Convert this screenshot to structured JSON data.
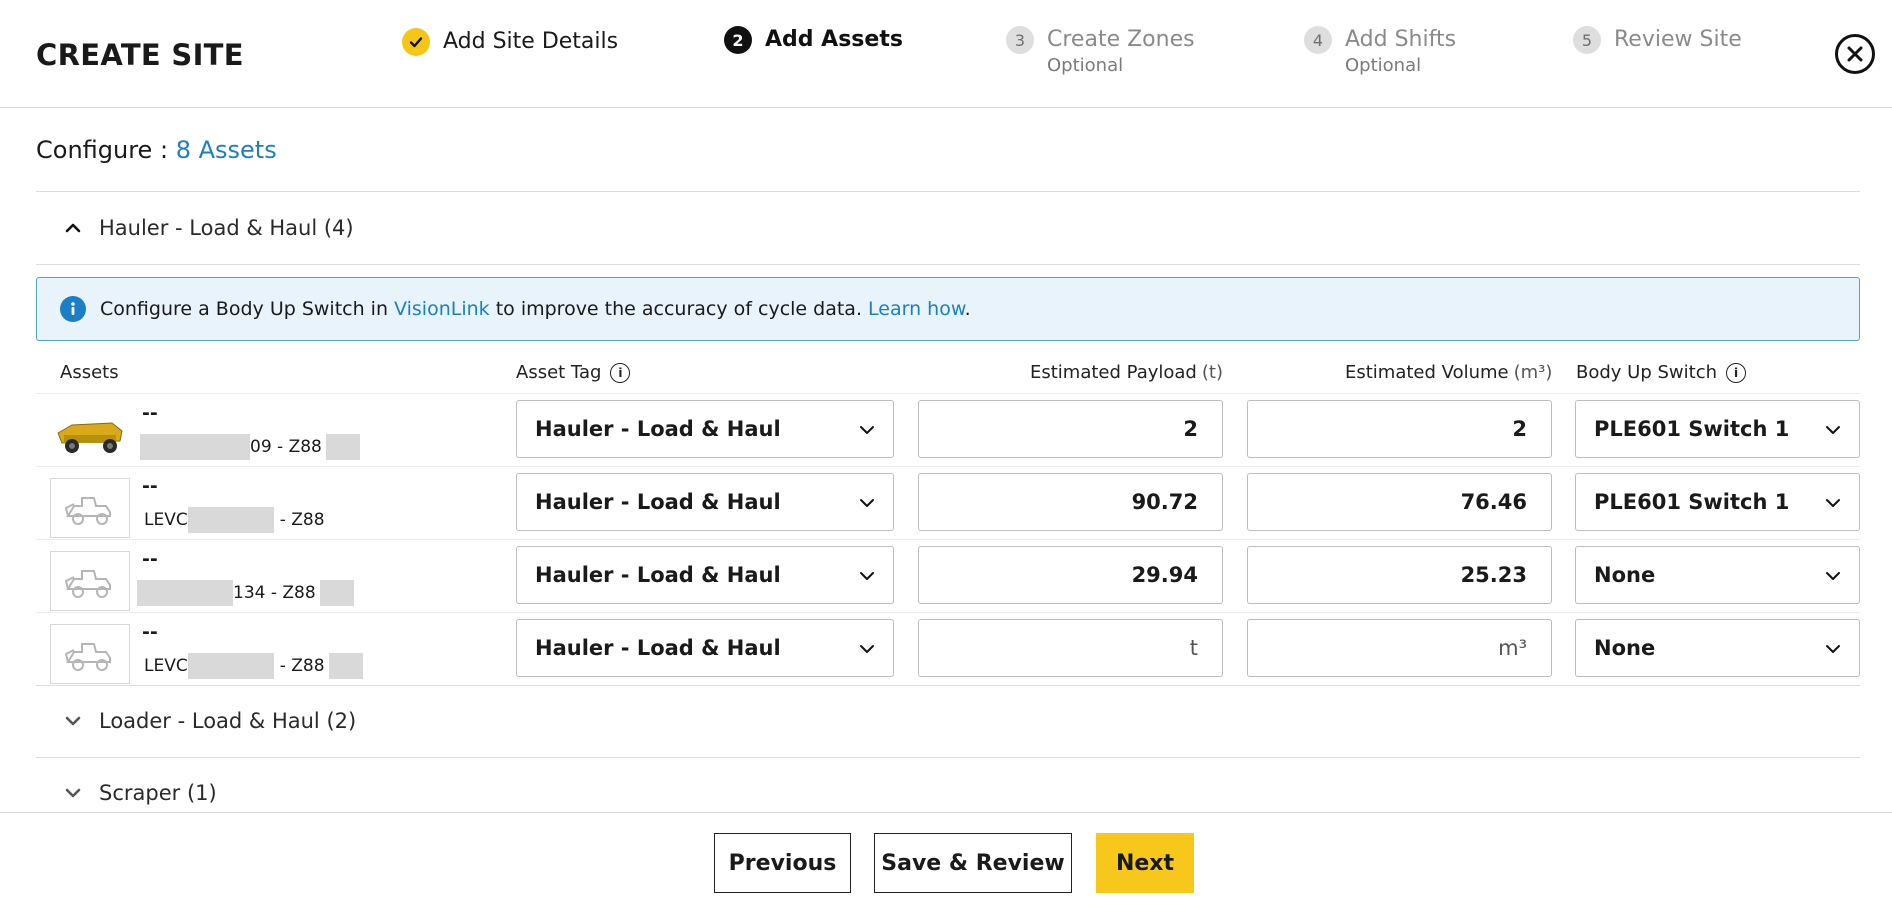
{
  "header": {
    "title": "CREATE SITE",
    "steps": [
      {
        "number": "1",
        "label": "Add Site Details",
        "sub": "",
        "state": "done"
      },
      {
        "number": "2",
        "label": "Add Assets",
        "sub": "",
        "state": "active"
      },
      {
        "number": "3",
        "label": "Create Zones",
        "sub": "Optional",
        "state": "pending"
      },
      {
        "number": "4",
        "label": "Add Shifts",
        "sub": "Optional",
        "state": "pending"
      },
      {
        "number": "5",
        "label": "Review Site",
        "sub": "",
        "state": "pending"
      }
    ]
  },
  "configure": {
    "label": "Configure :",
    "count": "8 Assets"
  },
  "groups": [
    {
      "title": "Hauler - Load & Haul (4)",
      "expanded": true
    },
    {
      "title": "Loader - Load & Haul (2)",
      "expanded": false
    },
    {
      "title": "Scraper (1)",
      "expanded": false
    }
  ],
  "banner": {
    "text_before": "Configure a Body Up Switch in ",
    "link1": "VisionLink",
    "text_middle": " to improve the accuracy of cycle data. ",
    "link2": "Learn how",
    "text_after": "."
  },
  "table": {
    "headers": {
      "assets": "Assets",
      "asset_tag": "Asset Tag",
      "payload": "Estimated Payload",
      "payload_unit": "(t)",
      "volume": "Estimated Volume",
      "volume_unit": "(m³)",
      "body_up_switch": "Body Up Switch"
    },
    "rows": [
      {
        "name": "--",
        "id_prefix": "",
        "id_suffix": "09 - Z88",
        "asset_tag": "Hauler - Load & Haul",
        "payload": "2",
        "volume": "2",
        "switch": "PLE601 Switch 1",
        "has_photo": true
      },
      {
        "name": "--",
        "id_prefix": "LEVC",
        "id_suffix": "- Z88",
        "asset_tag": "Hauler - Load & Haul",
        "payload": "90.72",
        "volume": "76.46",
        "switch": "PLE601 Switch 1",
        "has_photo": false
      },
      {
        "name": "--",
        "id_prefix": "",
        "id_suffix": "134 - Z88",
        "asset_tag": "Hauler - Load & Haul",
        "payload": "29.94",
        "volume": "25.23",
        "switch": "None",
        "has_photo": false
      },
      {
        "name": "--",
        "id_prefix": "LEVC",
        "id_suffix": "- Z88",
        "asset_tag": "Hauler - Load & Haul",
        "payload": "t",
        "volume": "m³",
        "switch": "None",
        "has_photo": false
      }
    ]
  },
  "footer": {
    "previous": "Previous",
    "save_review": "Save & Review",
    "next": "Next"
  },
  "colors": {
    "accent_yellow": "#f7c71c",
    "link_blue": "#1a7fc4",
    "banner_bg": "#e8f3fb"
  },
  "icons": {
    "step_done": "check-icon",
    "close": "close-circle-icon",
    "info": "info-icon",
    "expand": "chevron-up-icon",
    "collapse": "chevron-down-icon",
    "asset_placeholder": "loader-machine-icon",
    "asset_photo": "haul-truck-icon"
  }
}
